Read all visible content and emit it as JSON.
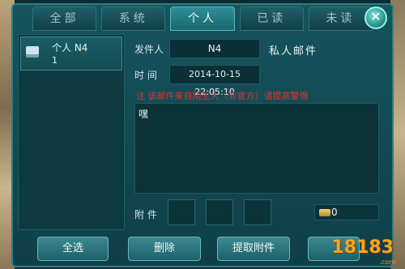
{
  "tabs": [
    {
      "label": "全部"
    },
    {
      "label": "系统"
    },
    {
      "label": "个人"
    },
    {
      "label": "已读"
    },
    {
      "label": "未读"
    }
  ],
  "active_tab": 2,
  "mail_list": [
    {
      "name": "个人 N4",
      "count": "1"
    }
  ],
  "detail": {
    "sender_label": "发件人",
    "sender_value": "N4",
    "mail_type": "私人邮件",
    "time_label": "时 间",
    "time_value": "2014-10-15 22:05:10",
    "warning": "注   该邮件来自陌生人（非官方）请提高警惕",
    "body": "嘿",
    "attachment_label": "附 件",
    "gold_value": "0"
  },
  "buttons": {
    "select_all": "全选",
    "delete": "删除",
    "extract": "提取附件"
  },
  "watermark": {
    "text": "18183",
    "sub": ".com"
  },
  "colors": {
    "accent": "#2e8f98",
    "warning": "#e0352c",
    "panel": "#17545e"
  }
}
